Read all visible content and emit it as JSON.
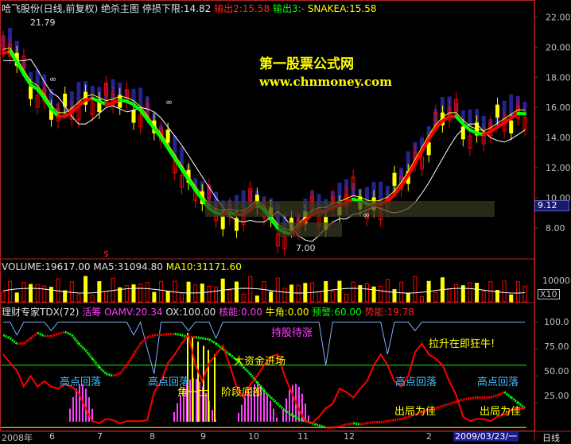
{
  "colors": {
    "bg": "#000000",
    "axis": "#b22222",
    "white": "#ffffff",
    "yellow": "#ffff00",
    "green": "#00ff00",
    "red": "#ff0000",
    "cyan": "#40c0ff",
    "magenta": "#ff40ff",
    "blue": "#2a2aa8",
    "orange": "#ff9900"
  },
  "header": {
    "stock": "哈飞股份(日线,前复权)",
    "indicator": "绝杀主图",
    "stop_loss": "停损下限:14.82",
    "out2": "输出2:15.58",
    "out3": "输出3:-",
    "snakea": "SNAKEA:15.58"
  },
  "watermark": {
    "title": "第一股票公式网",
    "url": "www.chnmoney.com"
  },
  "price_annotations": {
    "high": "21.79",
    "low": "7.00",
    "inf1": "∞",
    "inf2": "∞",
    "inf3": "∞",
    "dollar": "$",
    "last_price": "9.12"
  },
  "volume_header": {
    "volume": "VOLUME:19617.00",
    "ma5": "MA5:31094.80",
    "ma10": "MA10:31171.60"
  },
  "volume_axis": {
    "label": "10000",
    "unit": "X10"
  },
  "indicator_header": {
    "name": "理财专家TDX(72)",
    "huochou": "活筹 OAMV:20.34",
    "ox": "OX:100.00",
    "heneng": "核能:0.00",
    "niujiao": "牛角:0.00",
    "yujing": "预警:60.00",
    "shineng": "势能:19.78"
  },
  "indicator_labels": {
    "gaodian1": "高点回落",
    "gaodian2": "高点回落",
    "gaodian3": "高点回落",
    "gaodian4": "高点回落",
    "dazijin": "大资金进场",
    "jieduandibu": "阶段底部",
    "niuyishi": "角一士",
    "lasheng": "拉升在即狂牛!",
    "chuju1": "出局为佳",
    "chuju2": "出局为佳",
    "pink": "持股待涨"
  },
  "indicator_axis": [
    "100.0",
    "75.00",
    "50.00",
    "25.00"
  ],
  "bottom": {
    "year": "2008年",
    "months": [
      "6",
      "7",
      "8",
      "9",
      "10",
      "11",
      "12",
      "2"
    ],
    "date_box": "2009/03/23/一",
    "period": "日线"
  },
  "chart_data": [
    {
      "type": "line",
      "panel": "price",
      "yticks": [
        8,
        10,
        12,
        14,
        16,
        18,
        20,
        22
      ],
      "ylim": [
        7,
        22.6
      ],
      "series": [
        {
          "name": "SNAKEA",
          "values": [
            19.6,
            19.7,
            19.0,
            18.2,
            17.5,
            17.2,
            16.6,
            15.9,
            15.4,
            15.4,
            15.7,
            16.1,
            16.5,
            16.6,
            16.4,
            16.2,
            16.3,
            16.5,
            16.4,
            16.2,
            15.8,
            15.2,
            14.6,
            14.0,
            13.3,
            12.6,
            11.9,
            11.2,
            10.5,
            9.9,
            9.3,
            9.0,
            8.9,
            9.0,
            8.9,
            8.9,
            9.2,
            9.6,
            9.2,
            8.6,
            8.0,
            7.7,
            7.6,
            8.0,
            8.5,
            8.9,
            9.1,
            9.1,
            9.4,
            9.5,
            9.7,
            9.9,
            9.8,
            9.6,
            9.5,
            9.6,
            9.8,
            10.2,
            10.8,
            11.5,
            12.3,
            13.1,
            13.9,
            14.6,
            15.1,
            15.4,
            15.4,
            14.9,
            14.5,
            14.3,
            14.2,
            14.4,
            14.7,
            15.0,
            15.3,
            15.6,
            15.58
          ]
        }
      ]
    },
    {
      "type": "line",
      "panel": "indicator",
      "yticks": [
        25,
        50,
        75,
        100
      ],
      "ylim": [
        0,
        110
      ],
      "series": [
        {
          "name": "OX",
          "values": [
            100,
            100,
            88,
            100,
            100,
            100,
            100,
            92,
            100,
            100,
            100,
            100,
            100,
            100,
            100,
            100,
            100,
            100,
            100,
            88,
            100,
            75,
            52,
            100,
            100,
            100,
            100,
            92,
            100,
            100,
            100,
            85,
            100,
            100,
            100,
            100,
            100,
            100,
            100,
            100,
            100,
            100,
            100,
            100,
            100,
            100,
            100,
            60,
            100,
            100,
            100,
            100,
            100,
            100,
            100,
            100,
            70,
            100,
            100,
            100,
            92,
            100,
            100,
            100,
            100,
            100,
            100,
            100,
            100,
            100,
            100,
            100,
            100,
            100,
            100,
            100,
            100
          ]
        },
        {
          "name": "活筹",
          "values": [
            88,
            85,
            80,
            80,
            85,
            90,
            87,
            87,
            89,
            91,
            88,
            80,
            74,
            66,
            58,
            52,
            50,
            52,
            60,
            70,
            80,
            86,
            88,
            88,
            89,
            89,
            88,
            86,
            86,
            85,
            84,
            80,
            75,
            70,
            65,
            58,
            52,
            44,
            36,
            30,
            24,
            18,
            14,
            10,
            8,
            6,
            4,
            2,
            2,
            3,
            5,
            6,
            5,
            6,
            7,
            7,
            8,
            9,
            10,
            12,
            14,
            16,
            18,
            20,
            22,
            24,
            26,
            28,
            29,
            30,
            30,
            30,
            32,
            35,
            30,
            25,
            20
          ]
        },
        {
          "name": "势能",
          "values": [
            70,
            62,
            55,
            40,
            50,
            40,
            45,
            40,
            38,
            42,
            40,
            34,
            20,
            8,
            6,
            10,
            9,
            6,
            8,
            8,
            8,
            9,
            35,
            45,
            62,
            70,
            80,
            88,
            60,
            45,
            62,
            70,
            78,
            60,
            40,
            30,
            42,
            50,
            60,
            68,
            70,
            50,
            35,
            20,
            8,
            6,
            12,
            20,
            24,
            38,
            35,
            30,
            38,
            45,
            60,
            70,
            60,
            45,
            40,
            50,
            72,
            80,
            70,
            66,
            60,
            45,
            32,
            12,
            8,
            10,
            10,
            8,
            12,
            14,
            18,
            20,
            19.78
          ]
        }
      ]
    }
  ]
}
